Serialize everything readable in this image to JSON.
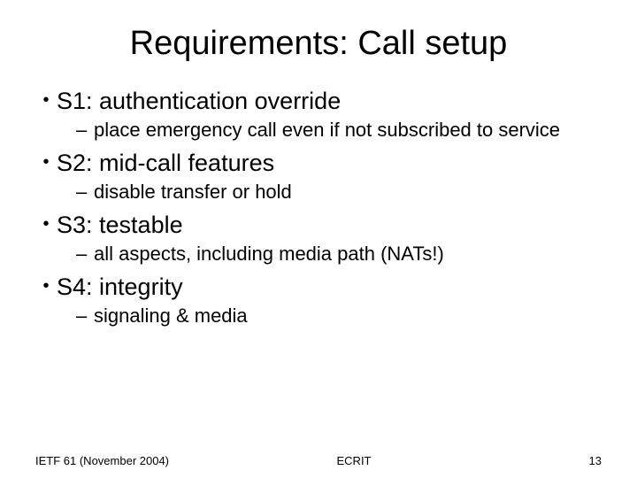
{
  "title": "Requirements: Call setup",
  "bullets": [
    {
      "label": "S1: authentication override",
      "sub": "place emergency call even if not subscribed to service"
    },
    {
      "label": "S2: mid-call features",
      "sub": "disable transfer or hold"
    },
    {
      "label": "S3: testable",
      "sub": "all aspects, including media path (NATs!)"
    },
    {
      "label": "S4: integrity",
      "sub": "signaling & media"
    }
  ],
  "footer": {
    "left": "IETF 61 (November 2004)",
    "center": "ECRIT",
    "right": "13"
  }
}
